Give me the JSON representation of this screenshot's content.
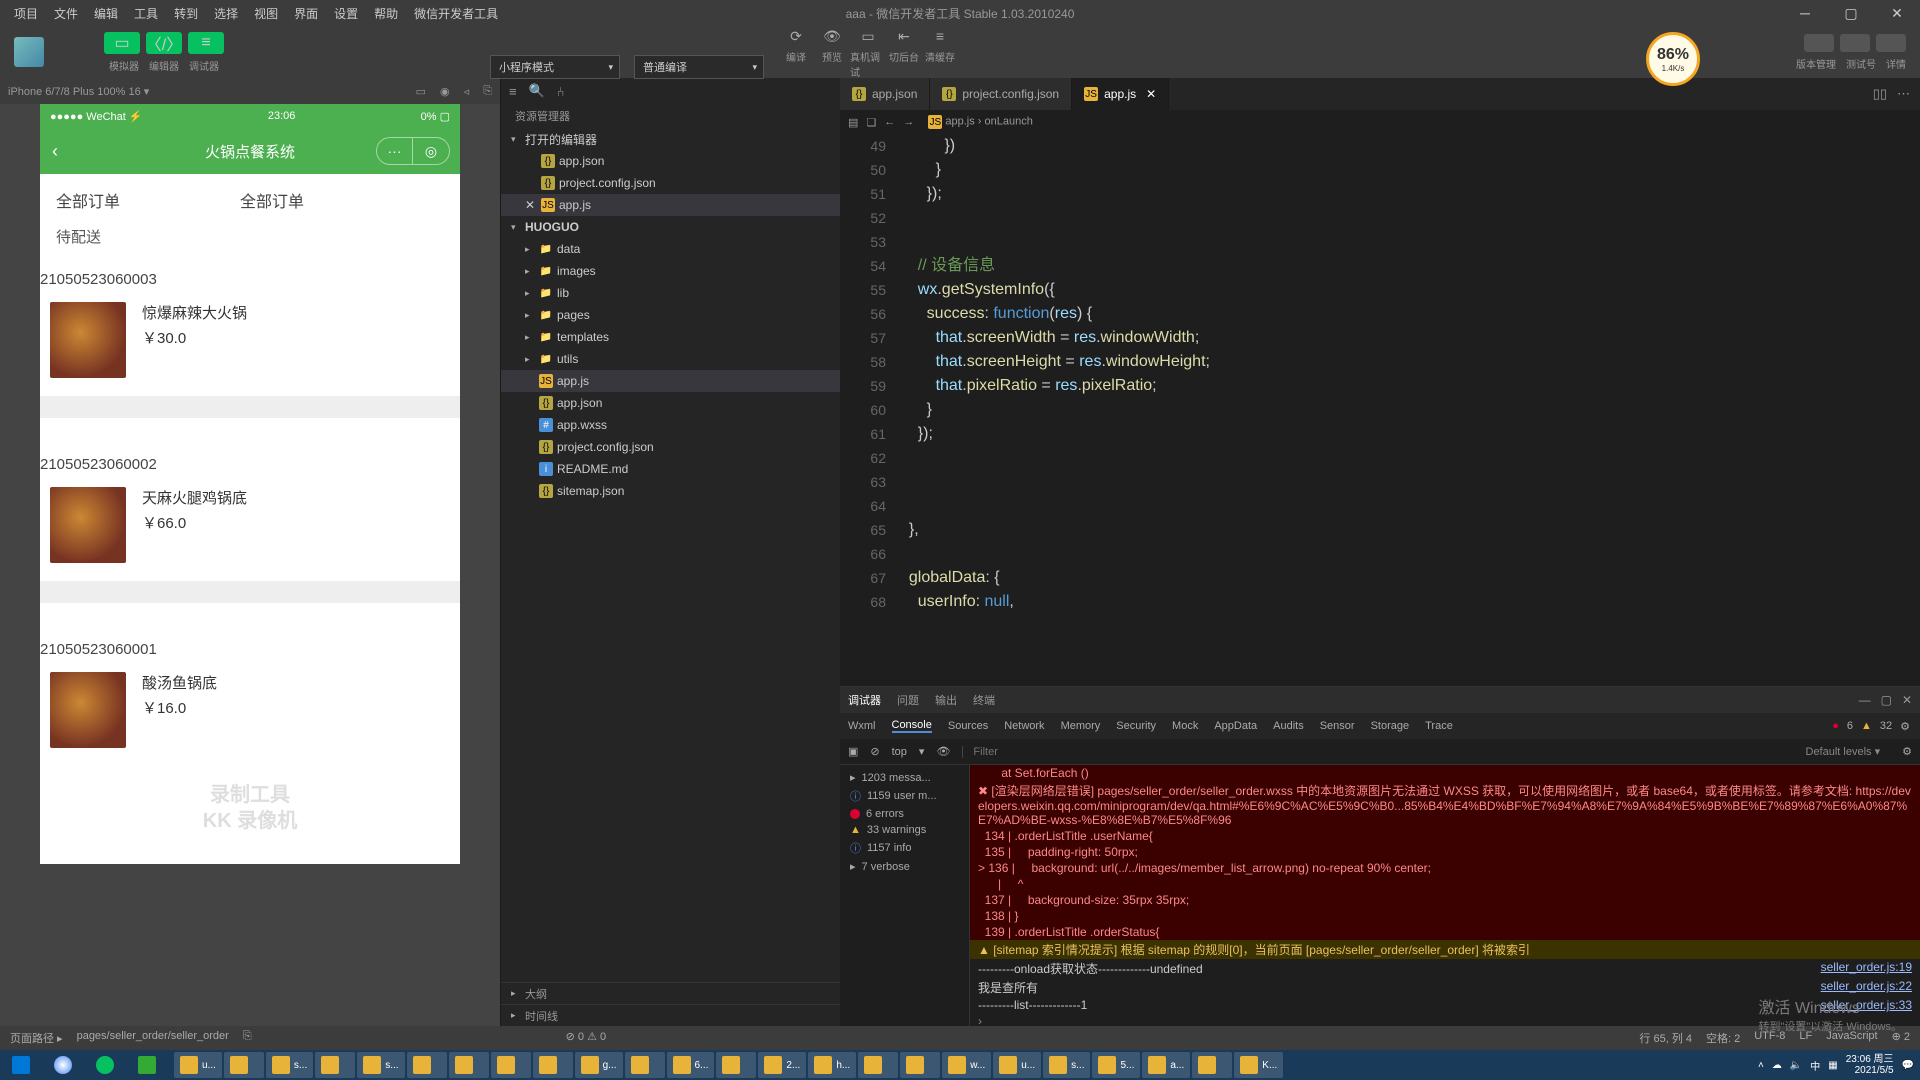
{
  "menus": [
    "项目",
    "文件",
    "编辑",
    "工具",
    "转到",
    "选择",
    "视图",
    "界面",
    "设置",
    "帮助",
    "微信开发者工具"
  ],
  "title": "aaa - 微信开发者工具 Stable 1.03.2010240",
  "toolbar": {
    "sim_lbls": [
      "模拟器",
      "编辑器",
      "调试器"
    ],
    "mode": "小程序模式",
    "compile": "普通编译",
    "actions": [
      "编译",
      "预览",
      "真机调试",
      "切后台",
      "清缓存"
    ],
    "score": "86%",
    "score_sub": "1.4K/s",
    "right_lbls": [
      "版本管理",
      "测试号",
      "详情"
    ]
  },
  "sim": {
    "device": "iPhone 6/7/8 Plus 100% 16 ▾",
    "status_l": "●●●●● WeChat ⚡",
    "status_c": "23:06",
    "status_r": "0% ▢",
    "nav_title": "火锅点餐系统",
    "tab1": "全部订单",
    "tab2": "全部订单",
    "subtab": "待配送",
    "orders": [
      {
        "id": "21050523060003",
        "name": "惊爆麻辣大火锅",
        "price": "￥30.0"
      },
      {
        "id": "21050523060002",
        "name": "天麻火腿鸡锅底",
        "price": "￥66.0"
      },
      {
        "id": "21050523060001",
        "name": "酸汤鱼锅底",
        "price": "￥16.0"
      }
    ],
    "watermark1": "录制工具",
    "watermark2": "KK 录像机"
  },
  "explorer": {
    "title": "资源管理器",
    "sections": {
      "open": "打开的编辑器",
      "project": "HUOGUO",
      "outline": "大纲",
      "timeline": "时间线"
    },
    "open_editors": [
      "app.json",
      "project.config.json",
      "app.js"
    ],
    "tree": [
      "data",
      "images",
      "lib",
      "pages",
      "templates",
      "utils",
      "app.js",
      "app.json",
      "app.wxss",
      "project.config.json",
      "README.md",
      "sitemap.json"
    ]
  },
  "tabs": [
    {
      "n": "app.json"
    },
    {
      "n": "project.config.json"
    },
    {
      "n": "app.js",
      "active": true
    }
  ],
  "breadcrumb": [
    "app.js",
    "onLaunch"
  ],
  "code": {
    "start": 49,
    "lines": [
      "          })",
      "        }",
      "      });",
      "",
      "",
      "    // 设备信息",
      "    wx.getSystemInfo({",
      "      success: function(res) {",
      "        that.screenWidth = res.windowWidth;",
      "        that.screenHeight = res.windowHeight;",
      "        that.pixelRatio = res.pixelRatio;",
      "      }",
      "    });",
      "",
      "",
      "",
      "  },",
      "",
      "  globalData: {",
      "    userInfo: null,"
    ]
  },
  "debugger": {
    "tabs": [
      "调试器",
      "问题",
      "输出",
      "终端"
    ],
    "subtabs": [
      "Wxml",
      "Console",
      "Sources",
      "Network",
      "Memory",
      "Security",
      "Mock",
      "AppData",
      "Audits",
      "Sensor",
      "Storage",
      "Trace"
    ],
    "badges": {
      "err": "6",
      "warn": "32"
    },
    "context": "top",
    "filter_ph": "Filter",
    "levels": "Default levels ▾",
    "left": [
      {
        "t": "1203 messa...",
        "i": ""
      },
      {
        "t": "1159 user m...",
        "i": "info"
      },
      {
        "t": "6 errors",
        "i": "err"
      },
      {
        "t": "33 warnings",
        "i": "warn"
      },
      {
        "t": "1157 info",
        "i": "info"
      },
      {
        "t": "7 verbose",
        "i": ""
      }
    ],
    "console": [
      {
        "cls": "con-err",
        "txt": "       at Set.forEach (<anonymous>)"
      },
      {
        "cls": "con-err",
        "txt": "✖ [渲染层网络层错误] pages/seller_order/seller_order.wxss 中的本地资源图片无法通过 WXSS 获取，可以使用网络图片，或者 base64，或者使用<image/>标签。请参考文档: https://developers.weixin.qq.com/miniprogram/dev/qa.html#%E6%9C%AC%E5%9C%B0...85%B4%E4%BD%BF%E7%94%A8%E7%9A%84%E5%9B%BE%E7%89%87%E6%A0%87%E7%AD%BE-wxss-%E8%8E%B7%E5%8F%96"
      },
      {
        "cls": "con-err",
        "txt": "  134 | .orderListTitle .userName{"
      },
      {
        "cls": "con-err",
        "txt": "  135 |     padding-right: 50rpx;"
      },
      {
        "cls": "con-err",
        "txt": "> 136 |     background: url(../../images/member_list_arrow.png) no-repeat 90% center;"
      },
      {
        "cls": "con-err",
        "txt": "      |     ^"
      },
      {
        "cls": "con-err",
        "txt": "  137 |     background-size: 35rpx 35rpx;"
      },
      {
        "cls": "con-err",
        "txt": "  138 | }"
      },
      {
        "cls": "con-err",
        "txt": "  139 | .orderListTitle .orderStatus{"
      },
      {
        "cls": "con-warn",
        "txt": "▲ [sitemap 索引情况提示] 根据 sitemap 的规则[0]，当前页面 [pages/seller_order/seller_order] 将被索引"
      },
      {
        "cls": "con-info",
        "txt": "---------onload获取状态-------------undefined",
        "link": "seller_order.js:19"
      },
      {
        "cls": "con-info",
        "txt": "我是查所有",
        "link": "seller_order.js:22"
      },
      {
        "cls": "con-info",
        "txt": "---------list-------------1",
        "link": "seller_order.js:33"
      }
    ]
  },
  "statusbar": {
    "path_lbl": "页面路径 ▸",
    "path": "pages/seller_order/seller_order",
    "problems": "⊘ 0 ⚠ 0",
    "right": [
      "行 65, 列 4",
      "空格: 2",
      "UTF-8",
      "LF",
      "JavaScript",
      "⊕ 2"
    ]
  },
  "activate": {
    "l1": "激活 Windows",
    "l2": "转到\"设置\"以激活 Windows。"
  },
  "taskbar": {
    "items": [
      "u...",
      "",
      "s...",
      "",
      "s...",
      "",
      "",
      "",
      "",
      "g...",
      "",
      "6...",
      "",
      "2...",
      "h...",
      "",
      "",
      "w...",
      "u...",
      "s...",
      "5...",
      "a...",
      "",
      "K..."
    ],
    "time": "23:06",
    "day": "周三",
    "date": "2021/5/5"
  }
}
